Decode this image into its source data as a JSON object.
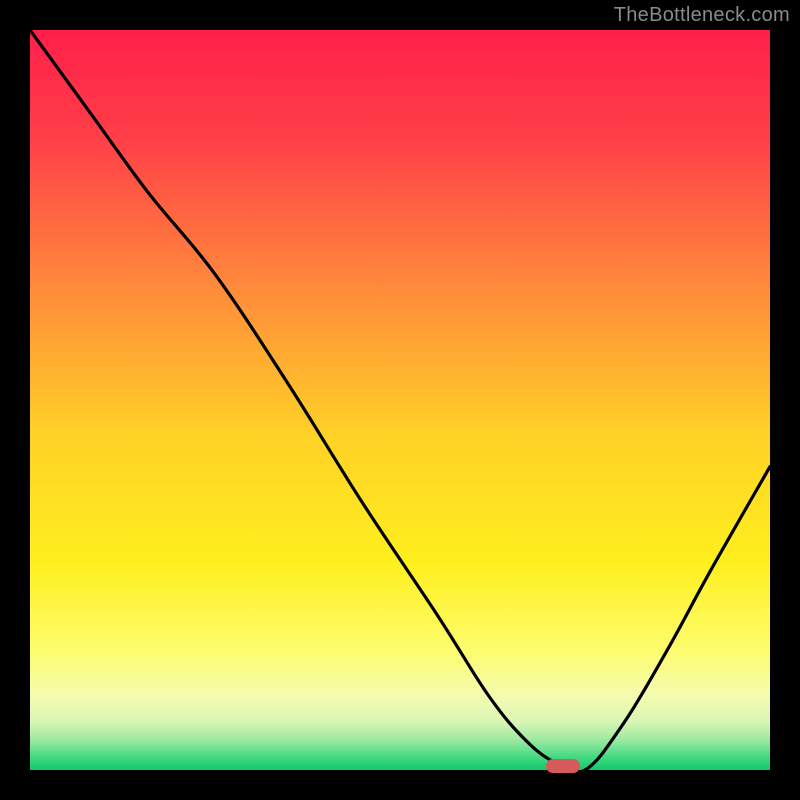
{
  "watermark": "TheBottleneck.com",
  "chart_data": {
    "type": "line",
    "title": "",
    "xlabel": "",
    "ylabel": "",
    "xlim": [
      0,
      100
    ],
    "ylim": [
      0,
      100
    ],
    "gradient_stops": [
      {
        "offset": 0.0,
        "color": "#ff1f4a"
      },
      {
        "offset": 0.15,
        "color": "#ff4048"
      },
      {
        "offset": 0.35,
        "color": "#ff8b3b"
      },
      {
        "offset": 0.55,
        "color": "#ffd226"
      },
      {
        "offset": 0.72,
        "color": "#ffef1e"
      },
      {
        "offset": 0.84,
        "color": "#fdfd70"
      },
      {
        "offset": 0.9,
        "color": "#f5fbb0"
      },
      {
        "offset": 0.935,
        "color": "#d9f6b4"
      },
      {
        "offset": 0.96,
        "color": "#9ae9a0"
      },
      {
        "offset": 0.985,
        "color": "#3bd77e"
      },
      {
        "offset": 1.0,
        "color": "#14c86b"
      }
    ],
    "series": [
      {
        "name": "bottleneck-curve",
        "x": [
          0,
          8,
          16,
          25,
          35,
          45,
          55,
          62,
          67,
          71,
          75,
          80,
          86,
          92,
          100
        ],
        "y": [
          100,
          89,
          78,
          67,
          52,
          36,
          21,
          10,
          4,
          1,
          0,
          6,
          16,
          27,
          41
        ]
      }
    ],
    "marker": {
      "x": 72,
      "y": 0.5,
      "label": "optimal-point"
    }
  }
}
